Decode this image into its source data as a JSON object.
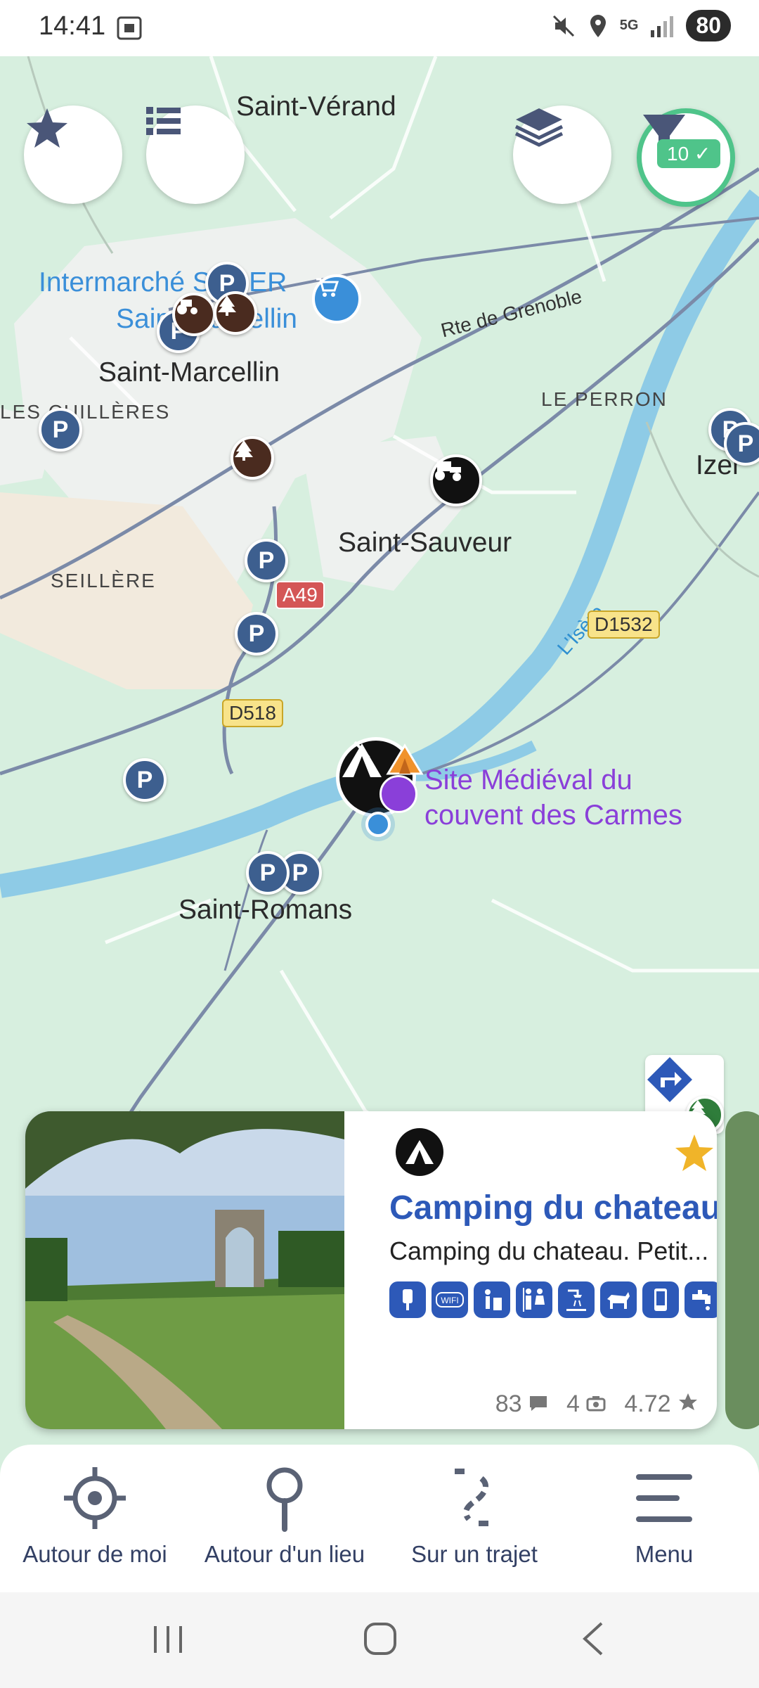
{
  "status_bar": {
    "time": "14:41",
    "battery": "80",
    "network": "5G"
  },
  "map": {
    "towns": {
      "saint_verand": "Saint-Vérand",
      "saint_marcellin": "Saint-Marcellin",
      "saint_sauveur": "Saint-Sauveur",
      "saint_romans": "Saint-Romans",
      "le_perron": "LE PERRON",
      "les_cuilleres": "LES CUILLÈRES",
      "seillere": "SEILLÈRE",
      "izer": "Izer"
    },
    "labels": {
      "intermarche_line1": "Intermarché SUPER",
      "intermarche_line2": "Saint-Marcellin",
      "rte_grenoble": "Rte de Grenoble",
      "river": "L'Isère",
      "site_line1": "Site Médiéval du",
      "site_line2": "couvent des Carmes"
    },
    "roads": {
      "a49": "A49",
      "d518": "D518",
      "d1532": "D1532"
    },
    "parking_letter": "P"
  },
  "buttons": {
    "filter_count": "10",
    "favorites_icon": "star-icon",
    "list_icon": "list-icon",
    "layers_icon": "layers-icon",
    "filter_icon": "filter-icon",
    "directions_icon": "directions-icon"
  },
  "card": {
    "title": "Camping du chateau",
    "description": "Camping du chateau. Petit...",
    "favorite": true,
    "amenities": [
      "electricity",
      "wifi",
      "trash",
      "toilets",
      "shower",
      "pets",
      "phone",
      "water"
    ],
    "stats": {
      "comments": "83",
      "photos": "4",
      "rating": "4.72"
    }
  },
  "bottom_nav": {
    "items": [
      {
        "label": "Autour de moi",
        "icon": "locate-icon"
      },
      {
        "label": "Autour d'un lieu",
        "icon": "pin-icon"
      },
      {
        "label": "Sur un trajet",
        "icon": "route-icon"
      },
      {
        "label": "Menu",
        "icon": "menu-icon"
      }
    ]
  },
  "colors": {
    "map_bg": "#d7efdf",
    "river": "#8ecbe6",
    "accent": "#2d59b8",
    "filter_green": "#4fc48a",
    "poi_purple": "#8a3fd9"
  }
}
